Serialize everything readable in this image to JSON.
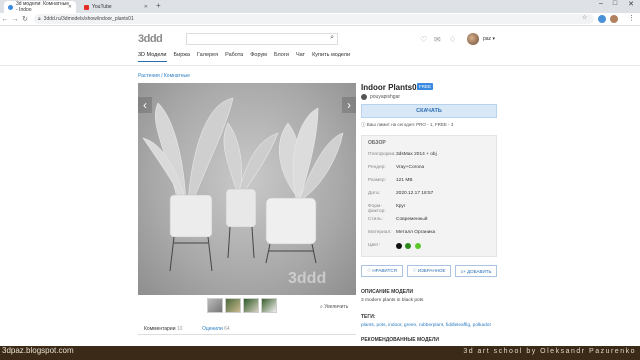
{
  "browser": {
    "tabs": [
      {
        "title": "3d модели: Комнатные - Indoo",
        "active": true,
        "favicon_color": "#3a8be0"
      },
      {
        "title": "YouTube",
        "active": false,
        "favicon_color": "#e52d27"
      }
    ],
    "new_tab": "+",
    "url": "3ddd.ru/3dmodels/show/indoor_plants01",
    "window_controls": [
      "–",
      "□",
      "✕"
    ]
  },
  "site": {
    "logo": "3ddd",
    "search_icon": "search-icon",
    "username": "paz ▾",
    "menu": [
      "3D Модели",
      "Биржа",
      "Галерея",
      "Работа",
      "Форум",
      "Блоги",
      "Чат",
      "Купить модели"
    ]
  },
  "breadcrumb": "Растения / Комнатные",
  "viewer": {
    "prev": "‹",
    "next": "›",
    "zoom_label": "Увеличить"
  },
  "bottom_tabs": {
    "comments": "Комментарии",
    "comments_count": "10",
    "ratings": "Оценили",
    "ratings_count": "64"
  },
  "model": {
    "title": "Indoor Plants01",
    "badge": "FREE",
    "author": "pouyapishgar",
    "download": "СКАЧАТЬ",
    "limit": "Ваш лимит на сегодня: PRO - 1, FREE - 3",
    "overview_title": "ОБЗОР",
    "specs": [
      {
        "key": "Платформа:",
        "value": "3dsMax 2014 + obj"
      },
      {
        "key": "Рендер:",
        "value": "Vray+Corona"
      },
      {
        "key": "Размер:",
        "value": "121 MB"
      },
      {
        "key": "Дата:",
        "value": "2020.12.17 18:57"
      },
      {
        "key": "Форм-фактор:",
        "value": "Круг"
      },
      {
        "key": "Стиль:",
        "value": "Современный"
      },
      {
        "key": "Материал:",
        "value": "Металл Органика"
      }
    ],
    "color_label": "Цвет:",
    "colors": [
      "#111111",
      "#2a8a1a",
      "#5ec72e"
    ],
    "buttons": {
      "like": "♡ НРАВИТСЯ",
      "favorite": "♡ ИЗБРАННОЕ",
      "add": "≡+ ДОБАВИТЬ"
    },
    "description_title": "ОПИСАНИЕ МОДЕЛИ",
    "description": "3 modern plants in black pots",
    "tags_title": "ТЕГИ:",
    "tags": "plants, pots, indoor, green, rubberplant, fiddleleaffig, polkadot",
    "recommended_title": "РЕКОМЕНДОВАННЫЕ МОДЕЛИ"
  },
  "overlay": {
    "blog": "3dpaz.blogspot.com",
    "school": "3d art school by Oleksandr Pazurenko"
  }
}
